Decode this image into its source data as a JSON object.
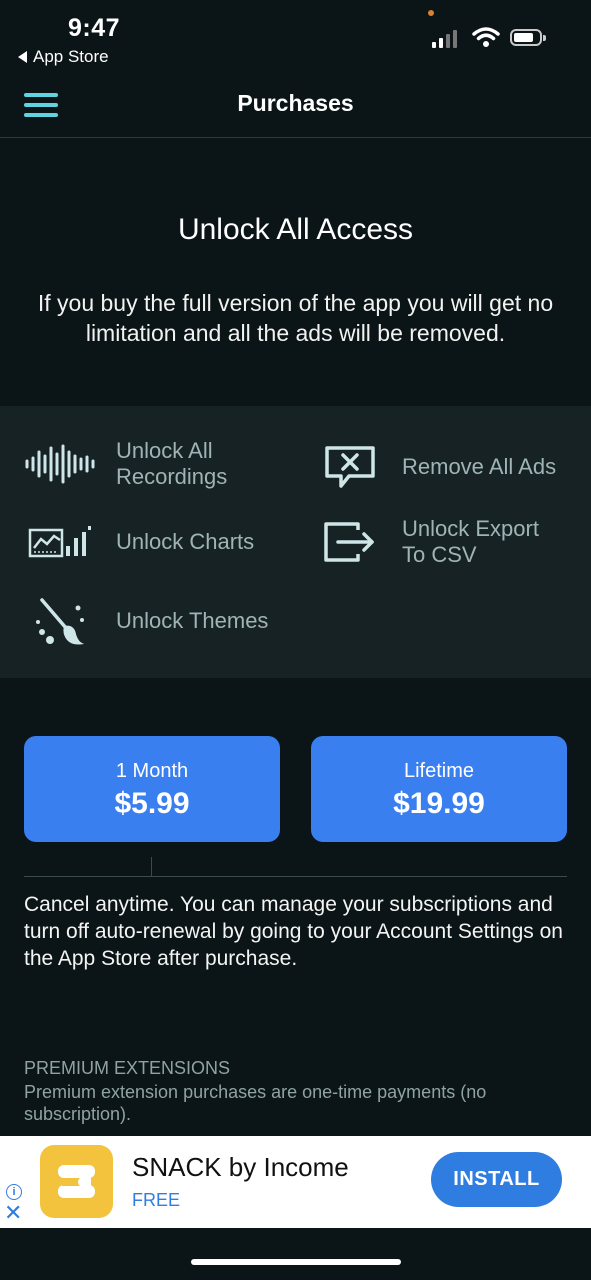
{
  "status_bar": {
    "time": "9:47",
    "back_app": "App Store"
  },
  "nav": {
    "title": "Purchases",
    "menu_icon": "hamburger-icon"
  },
  "hero": {
    "title": "Unlock All Access",
    "description": "If you buy the full version of the app you will get no limitation and all the ads will be removed."
  },
  "features": [
    {
      "label": "Unlock All Recordings",
      "icon": "waveform-icon"
    },
    {
      "label": "Remove All Ads",
      "icon": "no-ads-icon"
    },
    {
      "label": "Unlock Charts",
      "icon": "chart-icon"
    },
    {
      "label": "Unlock Export To CSV",
      "icon": "export-icon"
    },
    {
      "label": "Unlock Themes",
      "icon": "paintbrush-icon"
    }
  ],
  "plans": [
    {
      "period": "1 Month",
      "price": "$5.99"
    },
    {
      "period": "Lifetime",
      "price": "$19.99"
    }
  ],
  "cancel_note": "Cancel anytime. You can manage your subscriptions and turn off auto-renewal by going to your Account Settings on the App Store after purchase.",
  "premium": {
    "title": "PREMIUM EXTENSIONS",
    "description": "Premium extension purchases are one-time payments (no subscription)."
  },
  "ad": {
    "app_name": "SNACK by Income",
    "price": "FREE",
    "cta": "INSTALL",
    "info_glyph": "i",
    "close_glyph": "✕"
  },
  "colors": {
    "background": "#0b1416",
    "panel": "#172224",
    "accent_teal": "#5fd4e0",
    "button_blue": "#3a7ff0",
    "ad_blue": "#2f7de1"
  }
}
